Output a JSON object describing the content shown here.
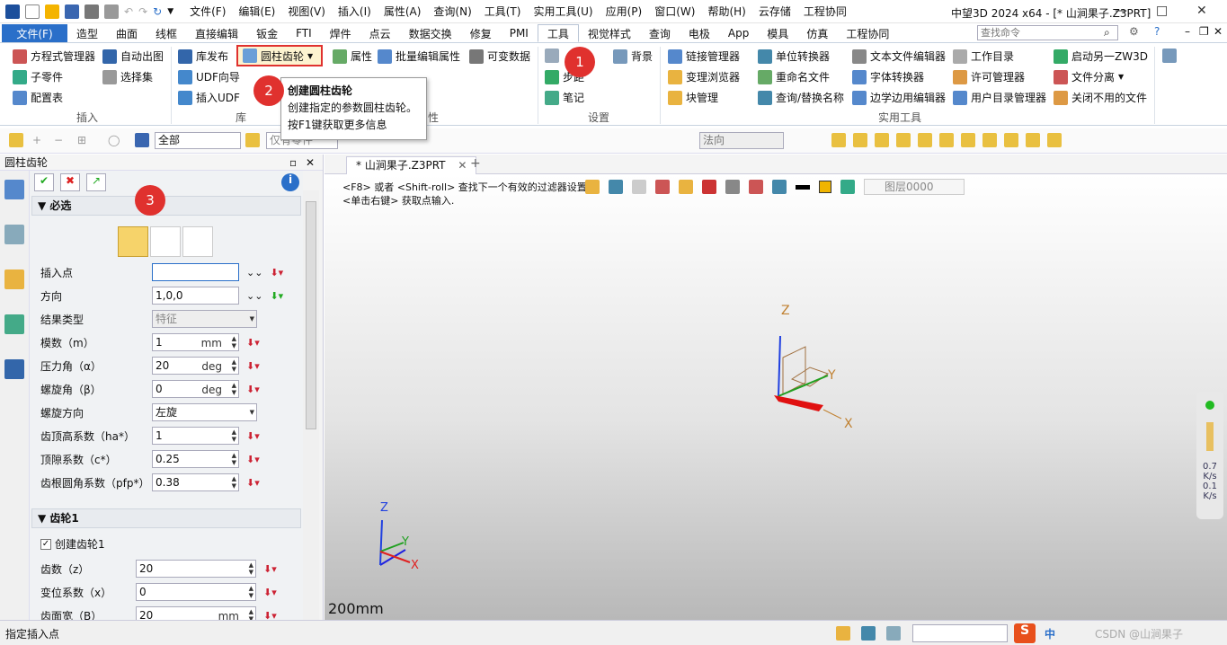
{
  "window": {
    "title": "中望3D 2024 x64 - [* 山涧果子.Z3PRT]",
    "minimize": "—",
    "maximize": "□",
    "close": "✕"
  },
  "menubar": [
    "文件(F)",
    "编辑(E)",
    "视图(V)",
    "插入(I)",
    "属性(A)",
    "查询(N)",
    "工具(T)",
    "实用工具(U)",
    "应用(P)",
    "窗口(W)",
    "帮助(H)",
    "云存储",
    "工程协同"
  ],
  "ribbon_tabs": {
    "file": "文件(F)",
    "tabs": [
      "造型",
      "曲面",
      "线框",
      "直接编辑",
      "钣金",
      "FTI",
      "焊件",
      "点云",
      "数据交换",
      "修复",
      "PMI",
      "工具",
      "视觉样式",
      "查询",
      "电极",
      "App",
      "模具",
      "仿真",
      "工程协同"
    ],
    "active": "工具",
    "search_placeholder": "查找命令"
  },
  "ribbon": {
    "insert": [
      "方程式管理器",
      "自动出图",
      "子零件",
      "选择集",
      "配置表"
    ],
    "library": [
      "库发布",
      "圆柱齿轮",
      "UDF向导",
      "插入UDF"
    ],
    "attr": [
      "属性",
      "批量编辑属性",
      "可变数据"
    ],
    "settings": [
      "背景",
      "步距",
      "笔记"
    ],
    "utilities": [
      "链接管理器",
      "单位转换器",
      "文本文件编辑器",
      "工作目录",
      "启动另一ZW3D",
      "变理浏览器",
      "重命名文件",
      "字体转换器",
      "许可管理器",
      "文件分离",
      "块管理",
      "查询/替换名称",
      "边学边用编辑器",
      "用户目录管理器",
      "关闭不用的文件"
    ],
    "groups": {
      "insert": "插入",
      "library": "库",
      "attr": "性",
      "settings": "设置",
      "utilities": "实用工具"
    }
  },
  "tooltip": {
    "title": "创建圆柱齿轮",
    "desc": "创建指定的参数圆柱齿轮。",
    "help": "按F1键获取更多信息"
  },
  "badges": [
    "1",
    "2",
    "3"
  ],
  "toolbar": {
    "filter": "全部",
    "part_filter": "仅有零件",
    "direction": "法向"
  },
  "panel": {
    "title": "圆柱齿轮",
    "required_section": "必选",
    "fields": [
      {
        "label": "插入点",
        "value": ""
      },
      {
        "label": "方向",
        "value": "1,0,0"
      },
      {
        "label": "结果类型",
        "value": "特征"
      },
      {
        "label": "模数（m）",
        "value": "1",
        "unit": "mm"
      },
      {
        "label": "压力角（α）",
        "value": "20",
        "unit": "deg"
      },
      {
        "label": "螺旋角（β）",
        "value": "0",
        "unit": "deg"
      },
      {
        "label": "螺旋方向",
        "value": "左旋"
      },
      {
        "label": "齿顶高系数（ha*）",
        "value": "1"
      },
      {
        "label": "顶隙系数（c*）",
        "value": "0.25"
      },
      {
        "label": "齿根圆角系数（pfp*）",
        "value": "0.38"
      }
    ],
    "gear1_section": "齿轮1",
    "create_gear1": "创建齿轮1",
    "gear1_fields": [
      {
        "label": "齿数（z）",
        "value": "20"
      },
      {
        "label": "变位系数（x）",
        "value": "0"
      },
      {
        "label": "齿面宽（B）",
        "value": "20",
        "unit": "mm"
      }
    ]
  },
  "doc_tab": "* 山涧果子.Z3PRT",
  "viewport": {
    "hint1": "<F8> 或者 <Shift-roll> 查找下一个有效的过滤器设置.",
    "hint2": "<单击右键> 获取点输入.",
    "layer": "图层0000",
    "scale": "200mm",
    "axes": {
      "x": "X",
      "y": "Y",
      "z": "Z"
    },
    "stats": [
      "0.7",
      "K/s",
      "0.1",
      "K/s"
    ]
  },
  "status": {
    "text": "指定插入点",
    "ime": "中",
    "watermark": "CSDN @山涧果子"
  }
}
